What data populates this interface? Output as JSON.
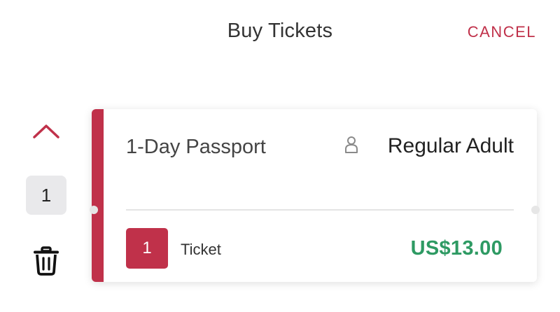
{
  "header": {
    "title": "Buy Tickets",
    "cancel_label": "CANCEL"
  },
  "stepper": {
    "quantity": "1",
    "up_icon": "chevron-up-icon",
    "delete_icon": "trash-icon"
  },
  "ticket_card": {
    "pass_name": "1-Day Passport",
    "person_icon": "person-icon",
    "ticket_type": "Regular Adult",
    "count": "1",
    "count_label": "Ticket",
    "price": "US$13.00"
  },
  "colors": {
    "accent": "#c0314a",
    "price": "#2e9a63",
    "qty_bg": "#e9e9eb"
  }
}
